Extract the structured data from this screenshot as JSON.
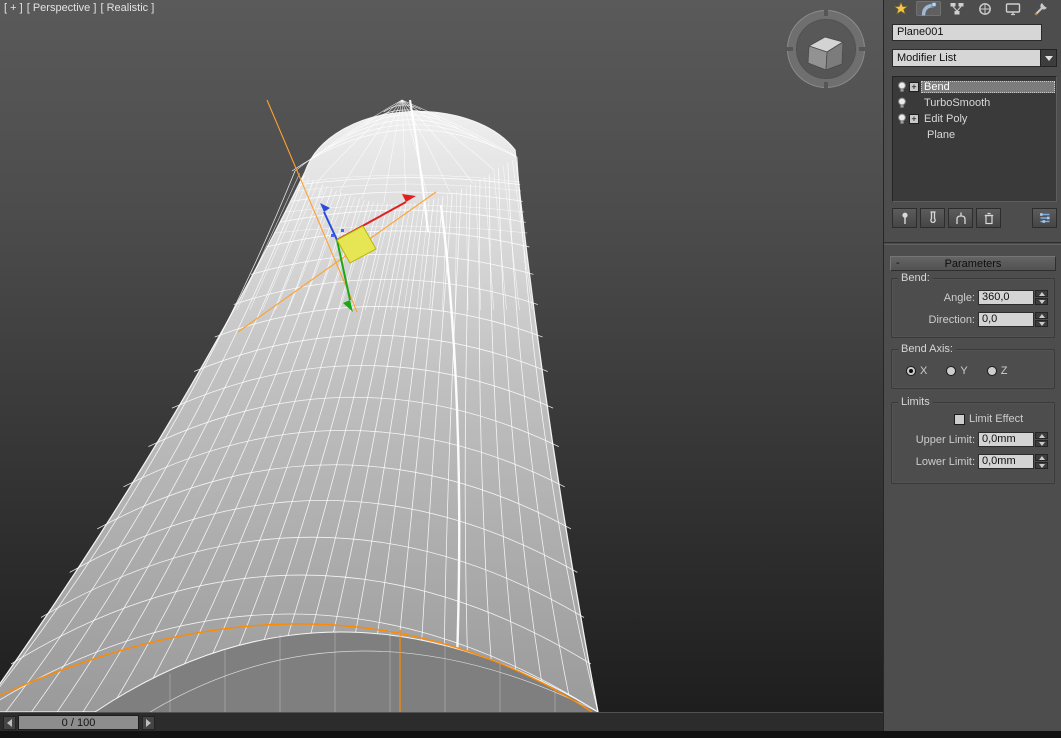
{
  "viewport": {
    "menu_plus": "[ + ]",
    "menu_pov": "[ Perspective ]",
    "menu_shading": "[ Realistic ]",
    "gizmo_count": "2"
  },
  "timeline": {
    "value": "0 / 100"
  },
  "panel": {
    "tabs": [
      "create",
      "modify",
      "hierarchy",
      "motion",
      "display",
      "utilities"
    ],
    "active_tab": "modify",
    "object_name": "Plane001",
    "modifier_list": "Modifier List",
    "stack": [
      {
        "label": "Bend",
        "toggle": "+",
        "selected": true
      },
      {
        "label": "TurboSmooth",
        "selected": false
      },
      {
        "label": "Edit Poly",
        "toggle": "+",
        "selected": false
      },
      {
        "label": "Plane",
        "selected": false
      }
    ],
    "stack_tools": [
      "pin-stack",
      "show-end-result",
      "make-unique",
      "remove-modifier",
      "configure-modifier-sets"
    ],
    "parameters": {
      "collapse_glyph": "-",
      "title": "Parameters",
      "bend": {
        "label": "Bend:",
        "angle_label": "Angle:",
        "angle_value": "360,0",
        "direction_label": "Direction:",
        "direction_value": "0,0"
      },
      "bend_axis": {
        "label": "Bend Axis:",
        "x": "X",
        "y": "Y",
        "z": "Z",
        "selected": "X"
      },
      "limits": {
        "label": "Limits",
        "limit_effect_label": "Limit Effect",
        "limit_effect_checked": false,
        "upper_label": "Upper Limit:",
        "upper_value": "0,0mm",
        "lower_label": "Lower Limit:",
        "lower_value": "0,0mm"
      }
    }
  },
  "colors": {
    "selection_orange": "#ff8a00",
    "axis_x_red": "#e02020",
    "axis_y_green": "#18a818",
    "axis_z_blue": "#2b4bdd",
    "plane_handle_yellow": "#e6e655",
    "configure_icon_blue": "#79aee2"
  }
}
